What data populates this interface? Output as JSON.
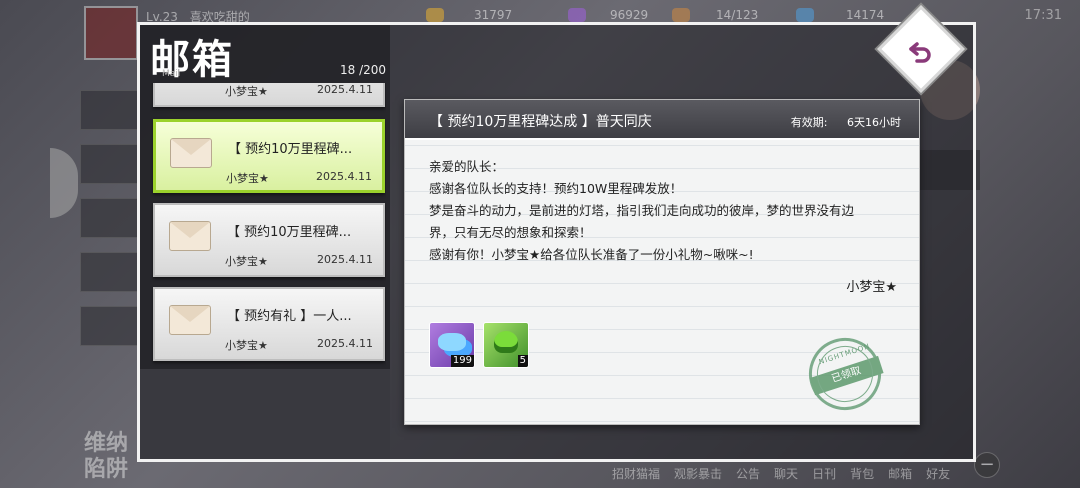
{
  "hud": {
    "level": "Lv.23",
    "player_name": "喜欢吃甜的",
    "resources": [
      {
        "icon": "gold-coin-icon",
        "value": "31797",
        "color": "#e8b030"
      },
      {
        "icon": "purple-gem-icon",
        "value": "96929",
        "color": "#a060e0"
      },
      {
        "icon": "stamina-box-icon",
        "value": "14/123",
        "color": "#d08a40"
      },
      {
        "icon": "blue-crystal-icon",
        "value": "14174",
        "color": "#50a0e0"
      }
    ],
    "time": "17:31",
    "bottom_nav": [
      "招财猫福",
      "观影暴击",
      "公告",
      "聊天",
      "日刊",
      "背包",
      "邮箱",
      "好友"
    ],
    "bg_title_line1": "维纳",
    "bg_title_line2": "陷阱"
  },
  "mailbox": {
    "title": "邮箱",
    "subtitle": "Mail",
    "count": "18 /200",
    "items": [
      {
        "title": "",
        "sender": "小梦宝★",
        "date": "2025.4.11"
      },
      {
        "title": "【 预约10万里程碑...",
        "sender": "小梦宝★",
        "date": "2025.4.11"
      },
      {
        "title": "【 预约10万里程碑...",
        "sender": "小梦宝★",
        "date": "2025.4.11"
      },
      {
        "title": "【 预约有礼 】一人...",
        "sender": "小梦宝★",
        "date": "2025.4.11"
      }
    ]
  },
  "mail": {
    "title": "【 预约10万里程碑达成 】普天同庆",
    "expiry_label": "有效期:",
    "expiry_value": "6天16小时",
    "body": [
      "亲爱的队长：",
      "感谢各位队长的支持！预约10W里程碑发放！",
      "梦是奋斗的动力，是前进的灯塔，指引我们走向成功的彼岸，梦的世界没有边",
      "界，只有无尽的想象和探索！",
      "感谢有你！小梦宝★给各位队长准备了一份小礼物~啾咪~!"
    ],
    "signature": "小梦宝★",
    "rewards": [
      {
        "icon": "blue-diamond-icon",
        "qty": "199"
      },
      {
        "icon": "green-heart-box-icon",
        "qty": "5"
      }
    ],
    "stamp_brand": "NIGHTMOON",
    "stamp_label": "已领取"
  }
}
